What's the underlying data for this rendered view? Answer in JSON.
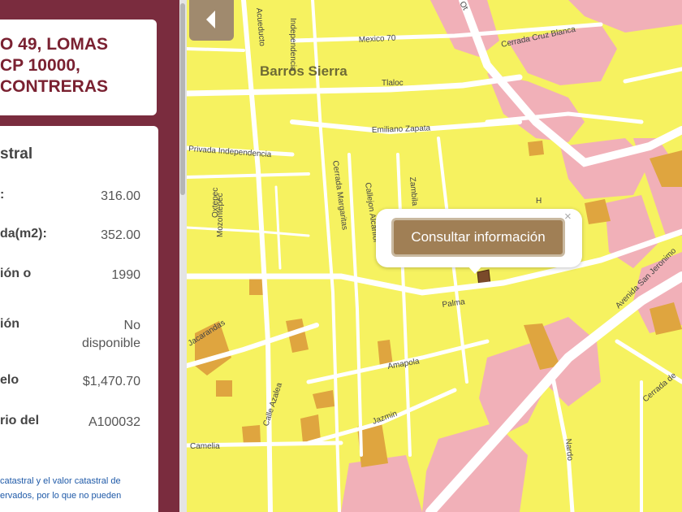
{
  "address": {
    "lines": [
      "O 49, LOMAS",
      "CP 10000,",
      "CONTRERAS"
    ]
  },
  "cadastral": {
    "section_title": "stral",
    "fields": [
      {
        "label": ":",
        "value": "316.00"
      },
      {
        "label": "da(m2):",
        "value": "352.00"
      },
      {
        "label": "ión o",
        "value": "1990"
      },
      {
        "label": "ión",
        "value": "No disponible"
      },
      {
        "label": "elo",
        "value": "$1,470.70"
      },
      {
        "label": "rio del",
        "value": "A100032"
      }
    ],
    "footnote_lines": [
      "catastral y el valor catastral de",
      "ervados, por lo que no pueden"
    ]
  },
  "map": {
    "neighborhood_label": "Barros Sierra",
    "streets": {
      "mexico": "Mexico 70",
      "cerrada_cruz_blanca": "Cerrada Cruz Blanca",
      "tlaloc": "Tlaloc",
      "emiliano_zapata": "Emiliano Zapata",
      "privada_independencia": "Privada Independencia",
      "oxtepec": "Oxtepec",
      "mozontepec": "Mozontepec",
      "cerrada_margaritas": "Cerrada Margaritas",
      "callejon_alcanfor": "Callejon Alcanfor",
      "palma": "Palma",
      "jacarandas": "Jacarandas",
      "amapola": "Amapola",
      "jazmin": "Jazmin",
      "camelia": "Camelia",
      "calle_azalea": "Calle Azalea",
      "nardo": "Nardo",
      "avenida_san_jeronimo": "Avenida San Jeronimo",
      "cerrada_de": "Cerrada de",
      "independencia": "Independencia",
      "acueducto": "Acueducto",
      "zamb": "Zambila",
      "hor": "H",
      "ot": "Ot"
    },
    "colors": {
      "residential": "#f6f260",
      "commercial": "#f1b0b8",
      "mixed": "#dfa53f",
      "selected_parcel": "#7a4a2a",
      "road": "#ffffff"
    }
  },
  "popup": {
    "button_label": "Consultar información",
    "close_glyph": "×"
  },
  "controls": {
    "back_icon": "chevron-left-icon"
  }
}
